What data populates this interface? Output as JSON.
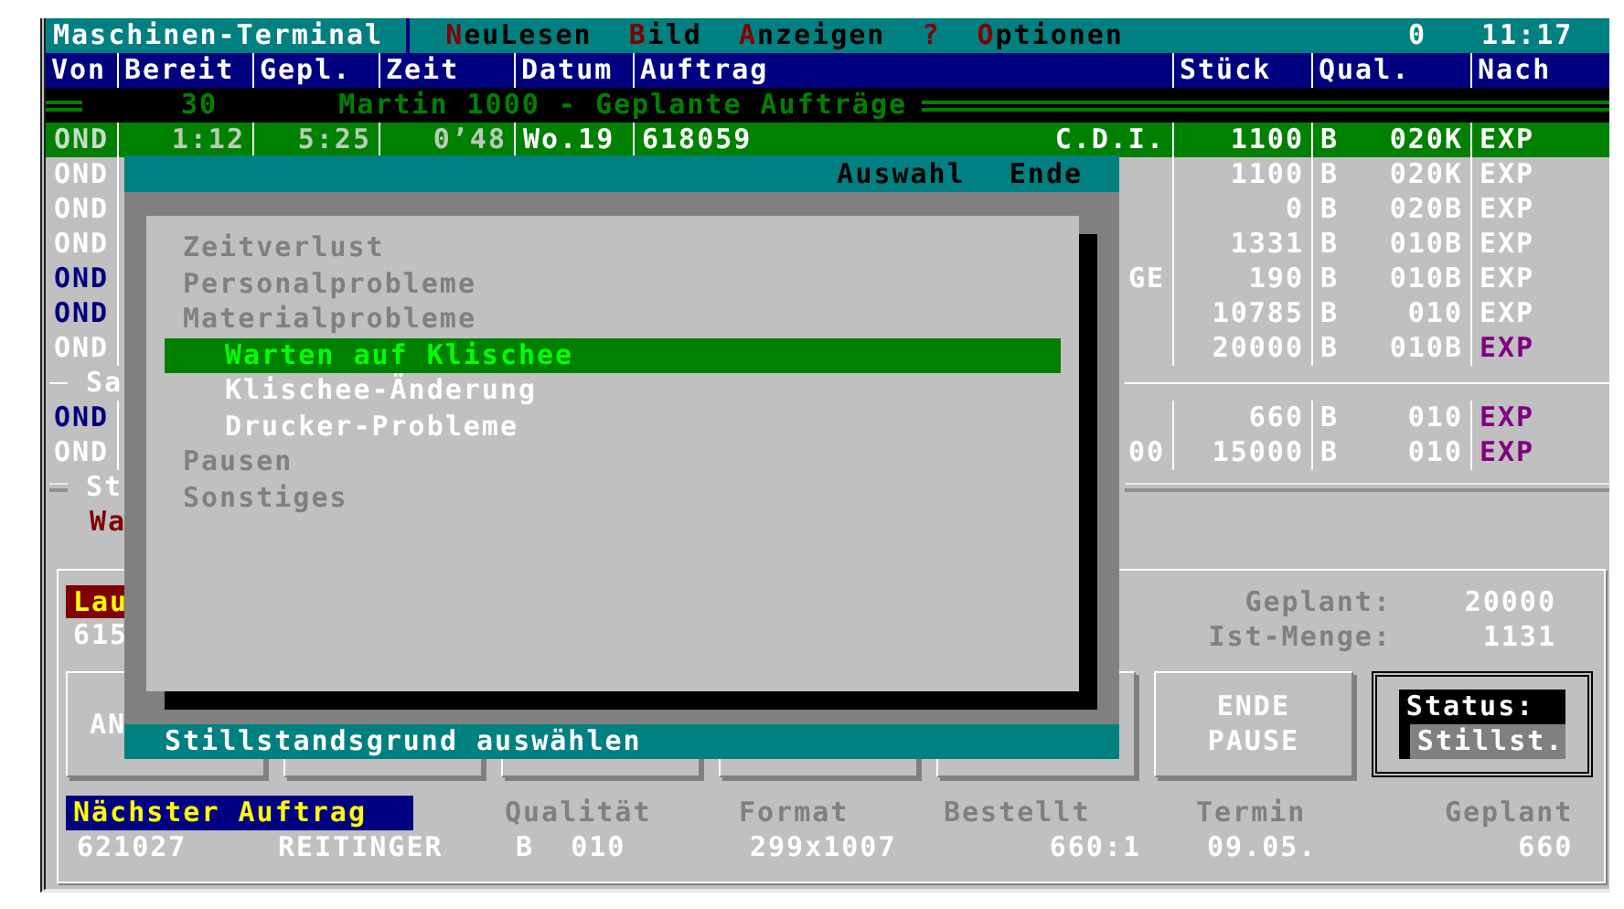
{
  "menu_bar": {
    "title": "Maschinen-Terminal",
    "items": [
      {
        "hotkey": "N",
        "rest": "euLesen"
      },
      {
        "hotkey": "B",
        "rest": "ild"
      },
      {
        "hotkey": "A",
        "rest": "nzeigen"
      },
      {
        "hotkey": "?"
      },
      {
        "hotkey": "O",
        "rest": "ptionen"
      }
    ],
    "counter": "0",
    "clock": "11:17"
  },
  "table": {
    "columns": [
      "Von",
      "Bereit",
      "Gepl.",
      "Zeit",
      "Datum",
      "Auftrag",
      "Stück",
      "Qual.",
      "Nach"
    ],
    "banner": {
      "number": "30",
      "title": "Martin 1000 - Geplante Aufträge"
    },
    "rows": [
      {
        "selected": true,
        "von": {
          "text": "OND",
          "color": "#c8dcc8"
        },
        "bereit": "1:12",
        "gepl": "5:25",
        "zeit": "0’48",
        "datum": "Wo.19",
        "auftrag": "618059",
        "kunde": "C.D.I.",
        "stueck": "1100",
        "qual": "B",
        "code": "020K",
        "nach": {
          "text": "EXP",
          "color": "#ffffff"
        }
      },
      {
        "selected": false,
        "von": {
          "text": "OND",
          "color": "#ffffff"
        },
        "stueck": "1100",
        "qual": "B",
        "code": "020K",
        "nach": {
          "text": "EXP",
          "color": "#ffffff"
        }
      },
      {
        "selected": false,
        "von": {
          "text": "OND",
          "color": "#ffffff"
        },
        "stueck": "0",
        "qual": "B",
        "code": "020B",
        "nach": {
          "text": "EXP",
          "color": "#ffffff"
        }
      },
      {
        "selected": false,
        "von": {
          "text": "OND",
          "color": "#ffffff"
        },
        "stueck": "1331",
        "qual": "B",
        "code": "010B",
        "nach": {
          "text": "EXP",
          "color": "#ffffff"
        }
      },
      {
        "selected": false,
        "von": {
          "text": "OND",
          "color": "#000080"
        },
        "auftrag_end": "GE",
        "stueck": "190",
        "qual": "B",
        "code": "010B",
        "nach": {
          "text": "EXP",
          "color": "#ffffff"
        }
      },
      {
        "selected": false,
        "von": {
          "text": "OND",
          "color": "#000080"
        },
        "stueck": "10785",
        "qual": "B",
        "code": "010",
        "nach": {
          "text": "EXP",
          "color": "#ffffff"
        }
      },
      {
        "selected": false,
        "von": {
          "text": "OND",
          "color": "#ffffff"
        },
        "stueck": "20000",
        "qual": "B",
        "code": "010B",
        "nach": {
          "text": "EXP",
          "color": "#800080"
        }
      }
    ],
    "group": {
      "title": "Sa",
      "rows": [
        {
          "selected": false,
          "von": {
            "text": "OND",
            "color": "#000080"
          },
          "stueck": "660",
          "qual": "B",
          "code": "010",
          "nach": {
            "text": "EXP",
            "color": "#800080"
          }
        },
        {
          "selected": false,
          "von": {
            "text": "OND",
            "color": "#ffffff"
          },
          "auftrag_end": "00",
          "stueck": "15000",
          "qual": "B",
          "code": "010",
          "nach": {
            "text": "EXP",
            "color": "#800080"
          }
        }
      ]
    },
    "section": {
      "title": "St",
      "line": "Wa"
    }
  },
  "current_job": {
    "label": "Lau",
    "number": "615",
    "planned_label": "Geplant:",
    "planned": "20000",
    "actual_label": "Ist-Menge:",
    "actual": "1131"
  },
  "buttons": [
    {
      "lines": [
        "AN"
      ]
    },
    {
      "covered": true
    },
    {
      "covered": true
    },
    {
      "covered": true
    },
    {
      "covered": true
    },
    {
      "lines": [
        "ENDE",
        "PAUSE"
      ]
    }
  ],
  "status": {
    "label": "Status:",
    "value": "Stillst."
  },
  "next_job": {
    "heading": "Nächster Auftrag",
    "fields": [
      {
        "value": "621027"
      },
      {
        "value": "REITINGER"
      },
      {
        "label": "Qualität",
        "value": "B  010"
      },
      {
        "label": "Format",
        "value": "299x1007"
      },
      {
        "label": "Bestellt",
        "value": "660:1"
      },
      {
        "label": "Termin",
        "value": "09.05."
      },
      {
        "label": "Geplant",
        "value": "660"
      }
    ]
  },
  "dialog": {
    "menu": [
      {
        "hotkey": "A",
        "rest": "uswahl"
      },
      {
        "before": "E",
        "hotkey": "n",
        "rest": "de"
      }
    ],
    "items": [
      {
        "label": "Zeitverlust",
        "selected": false
      },
      {
        "label": "Personalprobleme",
        "selected": false
      },
      {
        "label": "Materialprobleme",
        "selected": false,
        "children": [
          {
            "label": "Warten auf Klischee",
            "selected": true
          },
          {
            "label": "Klischee-Änderung",
            "selected": false
          },
          {
            "label": "Drucker-Probleme",
            "selected": false
          }
        ]
      },
      {
        "label": "Pausen",
        "selected": false
      },
      {
        "label": "Sonstiges",
        "selected": false
      }
    ],
    "footer": "Stillstandsgrund auswählen"
  }
}
